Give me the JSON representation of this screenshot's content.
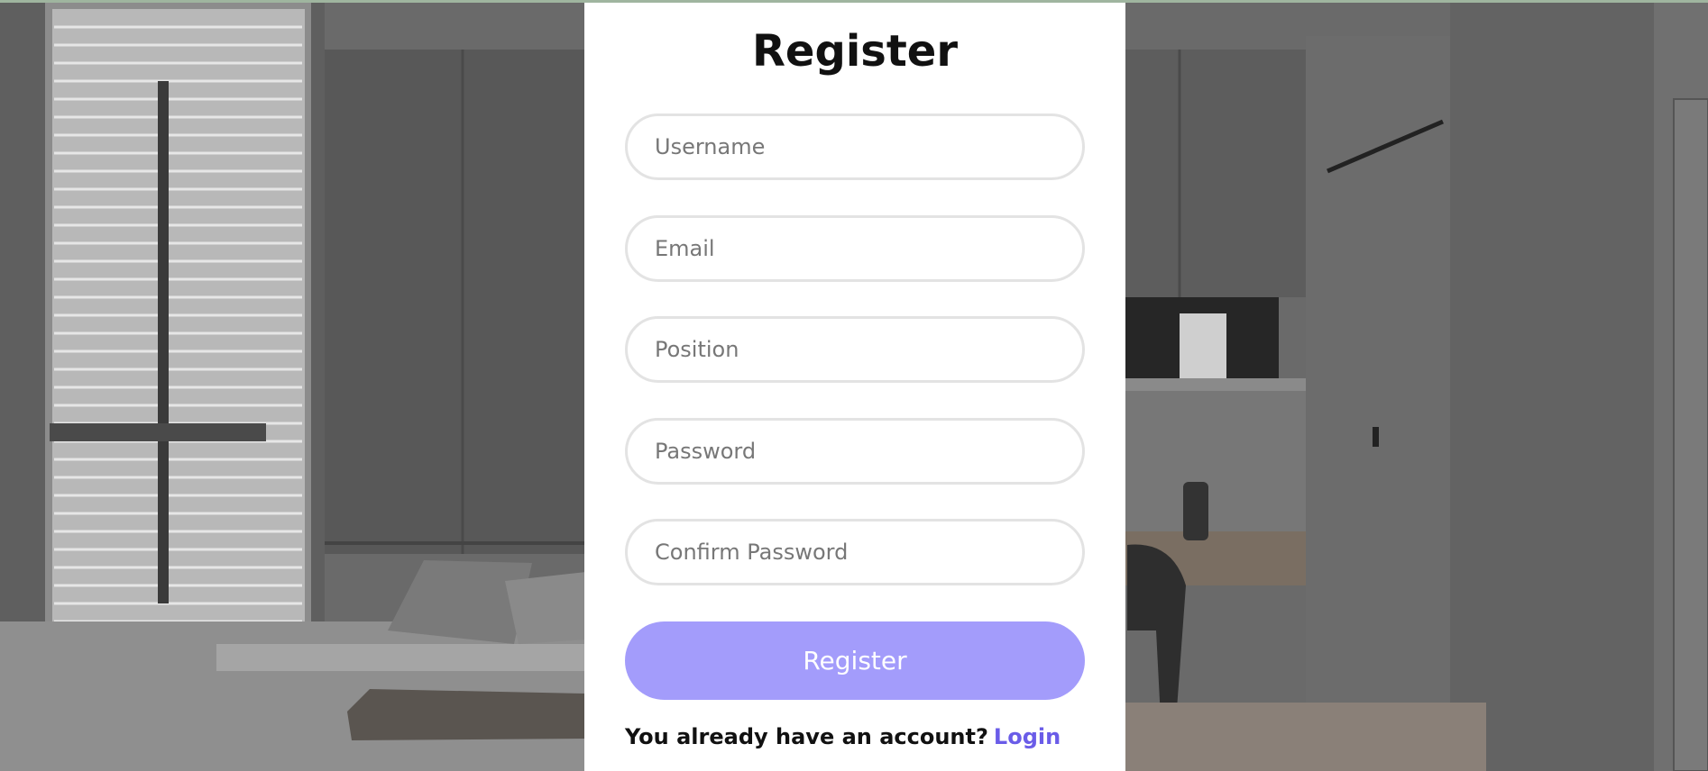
{
  "form": {
    "title": "Register",
    "fields": [
      {
        "placeholder": "Username"
      },
      {
        "placeholder": "Email"
      },
      {
        "placeholder": "Position"
      },
      {
        "placeholder": "Password"
      },
      {
        "placeholder": "Confirm Password"
      }
    ],
    "submit_label": "Register",
    "footer_text": "You already have an account?",
    "footer_link": "Login"
  },
  "colors": {
    "button": "#a39cfb",
    "link": "#6a5ce8"
  }
}
